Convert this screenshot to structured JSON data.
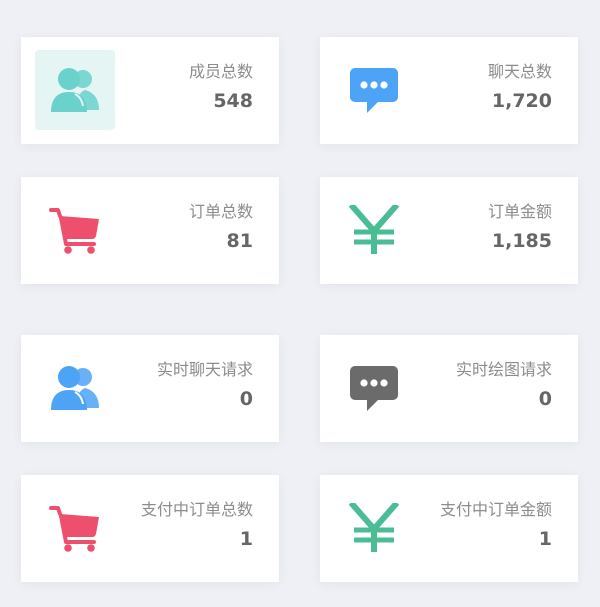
{
  "colors": {
    "members_teal": "#6ad1cb",
    "chat_blue": "#4da3f5",
    "order_red": "#ee4f6c",
    "money_green": "#4bbd95",
    "realtime_blue": "#4da3f5",
    "draw_gray": "#6b6b6b"
  },
  "stats": {
    "members": {
      "label": "成员总数",
      "value": "548",
      "icon": "users-icon"
    },
    "chats": {
      "label": "聊天总数",
      "value": "1,720",
      "icon": "chat-bubble-icon"
    },
    "orders": {
      "label": "订单总数",
      "value": "81",
      "icon": "shopping-cart-icon"
    },
    "order_amount": {
      "label": "订单金额",
      "value": "1,185",
      "icon": "yen-icon"
    },
    "realtime_chat": {
      "label": "实时聊天请求",
      "value": "0",
      "icon": "users-icon"
    },
    "realtime_draw": {
      "label": "实时绘图请求",
      "value": "0",
      "icon": "chat-bubble-icon"
    },
    "pending_orders": {
      "label": "支付中订单总数",
      "value": "1",
      "icon": "shopping-cart-icon"
    },
    "pending_amount": {
      "label": "支付中订单金额",
      "value": "1",
      "icon": "yen-icon"
    }
  }
}
